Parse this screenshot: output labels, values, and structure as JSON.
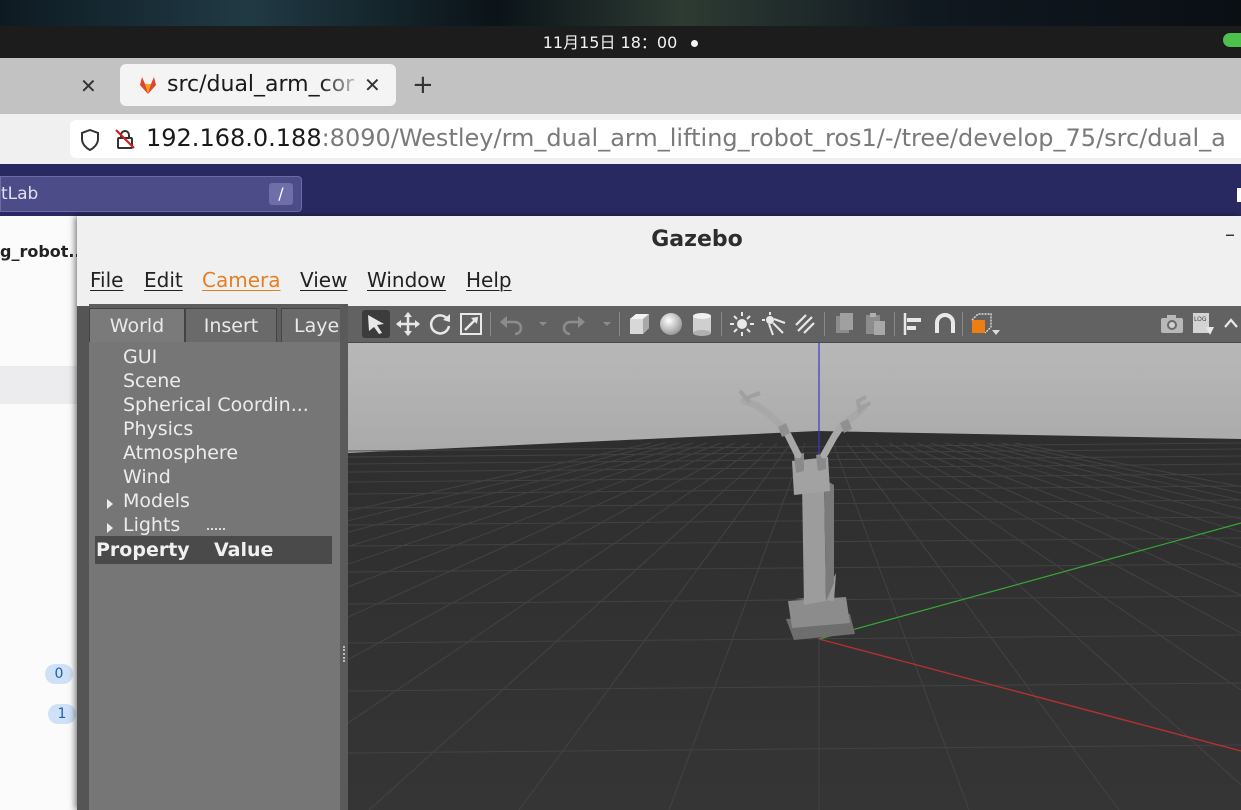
{
  "system_bar": {
    "clock": "11月15日 18：00"
  },
  "browser": {
    "active_tab_title": "src/dual_arm_cor",
    "url_host": "192.168.0.188",
    "url_rest": ":8090/Westley/rm_dual_arm_lifting_robot_ros1/-/tree/develop_75/src/dual_a"
  },
  "gitlab": {
    "search_text": "tLab",
    "search_shortcut": "/",
    "project_name": "g_robot...",
    "badges": [
      "0",
      "1"
    ]
  },
  "gazebo": {
    "window_title": "Gazebo",
    "menu": [
      "File",
      "Edit",
      "Camera",
      "View",
      "Window",
      "Help"
    ],
    "menu_accent": "#e67e22",
    "left_tabs": [
      "World",
      "Insert",
      "Layers"
    ],
    "world_tree": [
      {
        "label": "GUI",
        "expandable": false
      },
      {
        "label": "Scene",
        "expandable": false
      },
      {
        "label": "Spherical Coordin...",
        "expandable": false
      },
      {
        "label": "Physics",
        "expandable": false
      },
      {
        "label": "Atmosphere",
        "expandable": false
      },
      {
        "label": "Wind",
        "expandable": false
      },
      {
        "label": "Models",
        "expandable": true
      },
      {
        "label": "Lights",
        "expandable": true
      }
    ],
    "property_header": {
      "property": "Property",
      "value": "Value"
    },
    "toolbar_icons": [
      "select-arrow-icon",
      "translate-icon",
      "rotate-icon",
      "scale-icon",
      "undo-icon",
      "redo-icon",
      "box-icon",
      "sphere-icon",
      "cylinder-icon",
      "point-light-icon",
      "spot-light-icon",
      "directional-light-icon",
      "copy-icon",
      "paste-icon",
      "align-icon",
      "snap-icon",
      "view-angle-icon",
      "screenshot-icon",
      "log-icon"
    ],
    "colors": {
      "x_axis": "#b53030",
      "y_axis": "#36a836",
      "z_axis": "#3a3ad0",
      "sky": "#b3b3b3",
      "ground": "#323232"
    }
  }
}
